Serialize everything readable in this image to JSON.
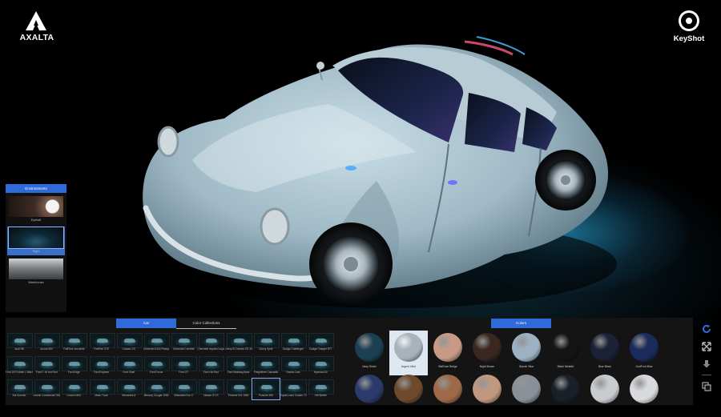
{
  "brand": {
    "left_logo": "AXALTA",
    "right_logo": "KeyShot"
  },
  "environments": {
    "title": "Environments",
    "items": [
      {
        "label": "Eyeball",
        "selected": false
      },
      {
        "label": "Night",
        "selected": true
      },
      {
        "label": "Warehouse",
        "selected": false
      }
    ]
  },
  "car_panel": {
    "tabs": [
      {
        "label": "Car",
        "active": true
      },
      {
        "label": "Color Collections",
        "active": false
      }
    ],
    "cars": [
      "Audi R8",
      "Acura NSX",
      "FallFlow Lincolnite",
      "FireFlite GTE",
      "Camaro ZX",
      "Chevrolet 3100 Pickup",
      "Chevrolet Corvette",
      "Chevrolet Impala Coupe",
      "Chevy El Camino SS 1969",
      "Chevy Spirit",
      "Dodge Challenger",
      "Dodge Charger R/T",
      "Ford 1970 Mach 1 Mach",
      "Ford F-16 Hot Rod",
      "Ford Edge",
      "Ford Explorer",
      "Ford Shelf",
      "Ford Focus",
      "Ford GT",
      "Ford Hot Rod",
      "Ford Mustang Boss",
      "Freightliner Cascadia",
      "Honda Civic",
      "Hyundai i30",
      "Kia Sorento",
      "Lincoln Continental 1962",
      "Lincoln MKZ",
      "Mach Truck",
      "Mercedes A",
      "Mercury Cougar 1969",
      "Mitsubishi Evo X",
      "Nissan GT-R",
      "Porsche 911 1960",
      "Porsche 356",
      "Toyota Land Cruiser 70",
      "VW Beetle"
    ],
    "selected_car": "Porsche 356"
  },
  "color_panel": {
    "tab": "Colors",
    "selected_color": "Argent Lithe",
    "colors": [
      {
        "label": "Navy Sinter",
        "color": "#1d3f52"
      },
      {
        "label": "Argent Lithe",
        "color": "#a8b2b8"
      },
      {
        "label": "BlaRose Bellge",
        "color": "#c89a86"
      },
      {
        "label": "Night Brown",
        "color": "#3a2820"
      },
      {
        "label": "Glacier Blue",
        "color": "#9cb2c4"
      },
      {
        "label": "Black Metallic",
        "color": "#141414"
      },
      {
        "label": "Blue Black",
        "color": "#1b2236"
      },
      {
        "label": "GodFord Blue",
        "color": "#1b2c5c"
      },
      {
        "label": "",
        "color": "#2a3a6a"
      },
      {
        "label": "",
        "color": "#6e4a2c"
      },
      {
        "label": "",
        "color": "#9c6a48"
      },
      {
        "label": "",
        "color": "#c09880"
      },
      {
        "label": "",
        "color": "#8a9098"
      },
      {
        "label": "",
        "color": "#1a2028"
      },
      {
        "label": "",
        "color": "#c8ccd0"
      },
      {
        "label": "",
        "color": "#d8dade"
      }
    ]
  },
  "toolbar": {
    "icons": [
      "refresh-icon",
      "fullscreen-icon",
      "download-icon",
      "copy-icon"
    ]
  },
  "accent": "#2f6bd8"
}
